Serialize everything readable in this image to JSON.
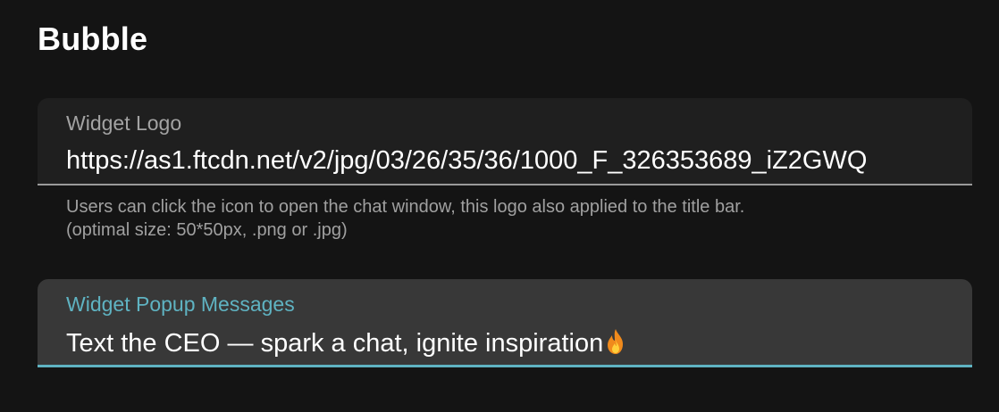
{
  "section": {
    "title": "Bubble"
  },
  "widget_logo": {
    "label": "Widget Logo",
    "value": "https://as1.ftcdn.net/v2/jpg/03/26/35/36/1000_F_326353689_iZ2GWQ",
    "helper_line1": "Users can click the icon to open the chat window, this logo also applied to the title bar.",
    "helper_line2": "(optimal size: 50*50px, .png or .jpg)"
  },
  "widget_popup": {
    "label": "Widget Popup Messages",
    "value": "Text the CEO — spark a chat, ignite inspiration",
    "trailing_icon": "fire-emoji"
  },
  "colors": {
    "background": "#141414",
    "accent": "#5fb3c2",
    "field_bg": "#1f1f1f",
    "field_bg_active": "#383838",
    "helper_text": "#a0a0a0"
  }
}
